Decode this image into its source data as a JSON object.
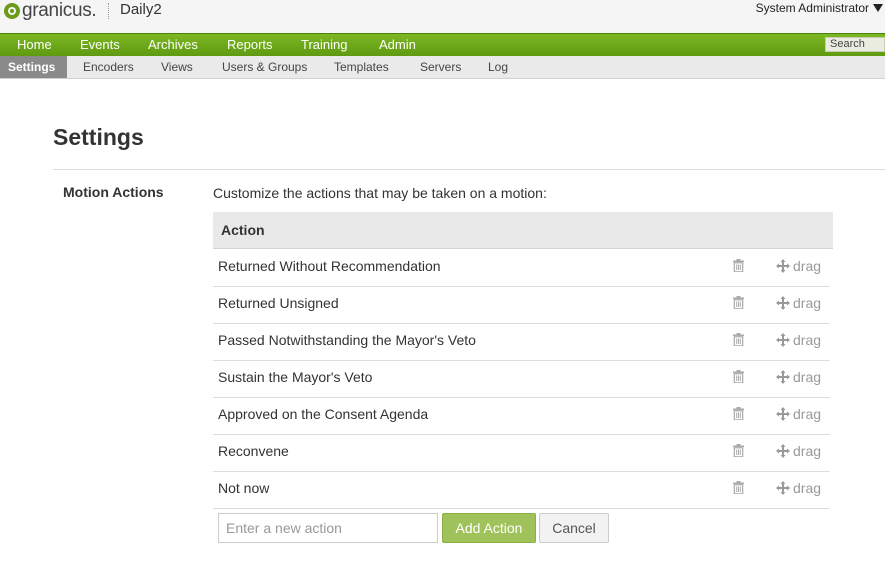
{
  "header": {
    "brand": "granicus.",
    "site_name": "Daily2",
    "user": "System Administrator"
  },
  "main_nav": {
    "items": [
      "Home",
      "Events",
      "Archives",
      "Reports",
      "Training",
      "Admin"
    ],
    "search_label": "Search"
  },
  "sub_nav": {
    "active": "Settings",
    "items": [
      "Encoders",
      "Views",
      "Users & Groups",
      "Templates",
      "Servers",
      "Log"
    ]
  },
  "page": {
    "title": "Settings",
    "section_label": "Motion Actions",
    "section_description": "Customize the actions that may be taken on a motion:"
  },
  "table": {
    "header": "Action",
    "drag_label": "drag",
    "rows": [
      "Returned Without Recommendation",
      "Returned Unsigned",
      "Passed Notwithstanding the Mayor's Veto",
      "Sustain the Mayor's Veto",
      "Approved on the Consent Agenda",
      "Reconvene",
      "Not now"
    ]
  },
  "form": {
    "placeholder": "Enter a new action",
    "add_label": "Add Action",
    "cancel_label": "Cancel"
  },
  "colors": {
    "nav_green": "#6fa71a",
    "add_button": "#9fc35a"
  }
}
